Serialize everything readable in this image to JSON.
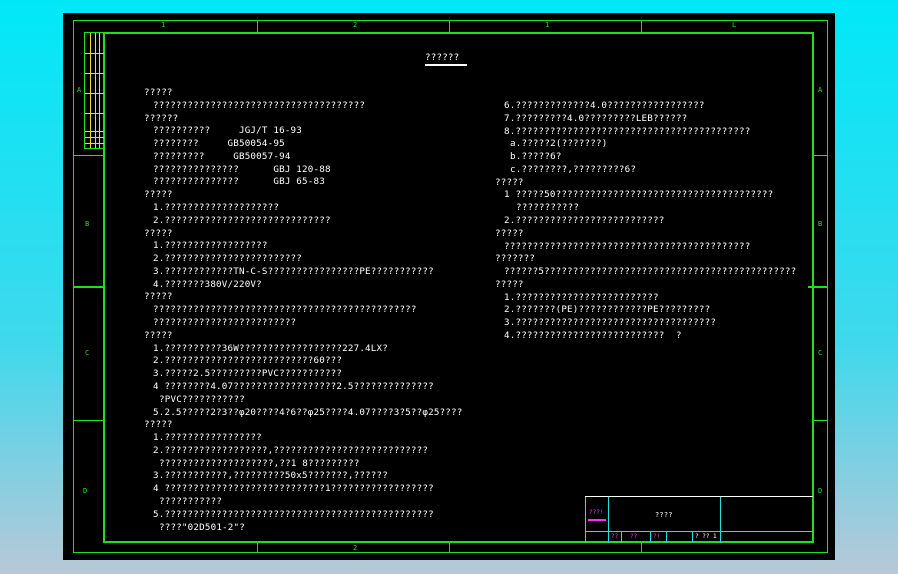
{
  "title": "??????",
  "ruler": {
    "top": [
      "1",
      "2",
      "1",
      "L"
    ],
    "side": [
      "A",
      "B",
      "C",
      "D"
    ]
  },
  "left": [
    {
      "i": 0,
      "t": "?????"
    },
    {
      "i": 1,
      "t": "?????????????????????????????????????"
    },
    {
      "i": 0,
      "t": "??????"
    },
    {
      "i": 1,
      "t": "??????????     JGJ/T 16-93"
    },
    {
      "i": 1,
      "t": "????????     GB50054-95"
    },
    {
      "i": 1,
      "t": "?????????     GB50057-94"
    },
    {
      "i": 1,
      "t": "???????????????      GBJ 120-88"
    },
    {
      "i": 1,
      "t": "???????????????      GBJ 65-83"
    },
    {
      "i": 0,
      "t": "?????"
    },
    {
      "i": 1,
      "t": "1.????????????????????"
    },
    {
      "i": 1,
      "t": "2.?????????????????????????????"
    },
    {
      "i": 0,
      "t": "?????"
    },
    {
      "i": 1,
      "t": "1.??????????????????"
    },
    {
      "i": 1,
      "t": "2.????????????????????????"
    },
    {
      "i": 1,
      "t": "3.????????????TN-C-S????????????????PE???????????"
    },
    {
      "i": 1,
      "t": "4.???????380V/220V?"
    },
    {
      "i": 0,
      "t": "?????"
    },
    {
      "i": 1,
      "t": "??????????????????????????????????????????????"
    },
    {
      "i": 1,
      "t": "?????????????????????????"
    },
    {
      "i": 0,
      "t": "?????"
    },
    {
      "i": 1,
      "t": "1.??????????36W??????????????????227.4LX?"
    },
    {
      "i": 1,
      "t": "2.??????????????????????????60???"
    },
    {
      "i": 1,
      "t": "3.?????2.5?????????PVC???????????"
    },
    {
      "i": 1,
      "t": "4 ????????4.07??????????????????2.5??????????????"
    },
    {
      "i": 2,
      "t": "?PVC???????????"
    },
    {
      "i": 1,
      "t": "5.2.5?????2?3??φ20????4?6??φ25????4.07????3?5??φ25????"
    },
    {
      "i": 0,
      "t": "?????"
    },
    {
      "i": 1,
      "t": "1.?????????????????"
    },
    {
      "i": 1,
      "t": "2.??????????????????,???????????????????????????"
    },
    {
      "i": 2,
      "t": "????????????????????,??1 8?????????"
    },
    {
      "i": 1,
      "t": "3.???????????,?????????50x5???????,??????"
    },
    {
      "i": 1,
      "t": "4 ????????????????????????????1??????????????????"
    },
    {
      "i": 2,
      "t": "???????????"
    },
    {
      "i": 1,
      "t": "5.???????????????????????????????????????????????"
    },
    {
      "i": 2,
      "t": "????\"02D501-2\"?"
    }
  ],
  "right": [
    {
      "i": 1,
      "t": "6.?????????????4.0?????????????????"
    },
    {
      "i": 1,
      "t": "7.?????????4.0?????????LEB??????"
    },
    {
      "i": 1,
      "t": "8.?????????????????????????????????????????"
    },
    {
      "i": 2,
      "t": "a.?????2(???????)"
    },
    {
      "i": 2,
      "t": "b.?????6?"
    },
    {
      "i": 2,
      "t": "c.????????,?????????6?"
    },
    {
      "i": 0,
      "t": "?????"
    },
    {
      "i": 1,
      "t": "1 ?????50??????????????????????????????????????"
    },
    {
      "i": 3,
      "t": "???????????"
    },
    {
      "i": 1,
      "t": "2.??????????????????????????"
    },
    {
      "i": 0,
      "t": "?????"
    },
    {
      "i": 1,
      "t": "???????????????????????????????????????????"
    },
    {
      "i": 0,
      "t": "???????"
    },
    {
      "i": 1,
      "t": "??????5????????????????????????????????????????????"
    },
    {
      "i": 0,
      "t": "?????"
    },
    {
      "i": 1,
      "t": "1.?????????????????????????"
    },
    {
      "i": 1,
      "t": "2.???????(PE)????????????PE?????????"
    },
    {
      "i": 1,
      "t": "3.???????????????????????????????????"
    },
    {
      "i": 1,
      "t": "4.??????????????????????????  ?"
    }
  ],
  "titleblock": {
    "label": "???!",
    "name": "????",
    "cells": [
      "??",
      "??",
      "?!",
      "? ?? 1"
    ]
  }
}
